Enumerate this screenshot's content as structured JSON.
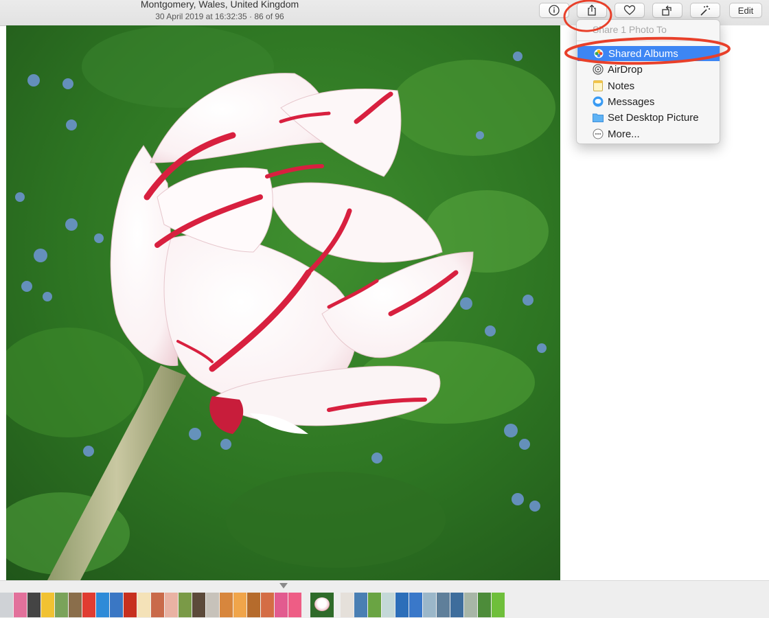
{
  "toolbar": {
    "location_title": "Montgomery, Wales, United Kingdom",
    "subtitle": "30 April 2019 at 16:32:35 · 86 of 96",
    "edit_label": "Edit",
    "icons": [
      "info-icon",
      "share-icon",
      "heart-icon",
      "rotate-icon",
      "magic-wand-icon"
    ]
  },
  "share_menu": {
    "header": "Share 1 Photo To",
    "items": [
      {
        "label": "Shared Albums",
        "icon": "shared-albums-icon",
        "selected": true
      },
      {
        "label": "AirDrop",
        "icon": "airdrop-icon"
      },
      {
        "label": "Notes",
        "icon": "notes-icon"
      },
      {
        "label": "Messages",
        "icon": "messages-icon"
      },
      {
        "label": "Set Desktop Picture",
        "icon": "folder-icon"
      },
      {
        "label": "More...",
        "icon": "more-icon"
      }
    ]
  },
  "colors": {
    "menu_highlight": "#3d86f4",
    "annotation_red": "#e8402a",
    "petal_red": "#d8203f"
  },
  "filmstrip": {
    "thumb_colors": [
      "#cfd2d6",
      "#e2719b",
      "#444444",
      "#f1c232",
      "#7aa35a",
      "#8a6e4b",
      "#e03c31",
      "#2e8bd8",
      "#3a77c4",
      "#c7301f",
      "#f4e2b8",
      "#c96a4a",
      "#e9b2a3",
      "#7a9a47",
      "#5c4a3a",
      "#c7c2ba",
      "#d7863d",
      "#f0a54a",
      "#b56b2c",
      "#d46d45",
      "#e25b8f",
      "#ee5d85"
    ],
    "thumb_colors_after": [
      "#e5e0da",
      "#4a7fb3",
      "#6aa443",
      "#c4d8d8",
      "#2c6eb9",
      "#3a78c9",
      "#9bb7c9",
      "#5f7f9a",
      "#3e6d9c",
      "#a8b6a7",
      "#4d8c3a",
      "#6fbf3b"
    ]
  }
}
